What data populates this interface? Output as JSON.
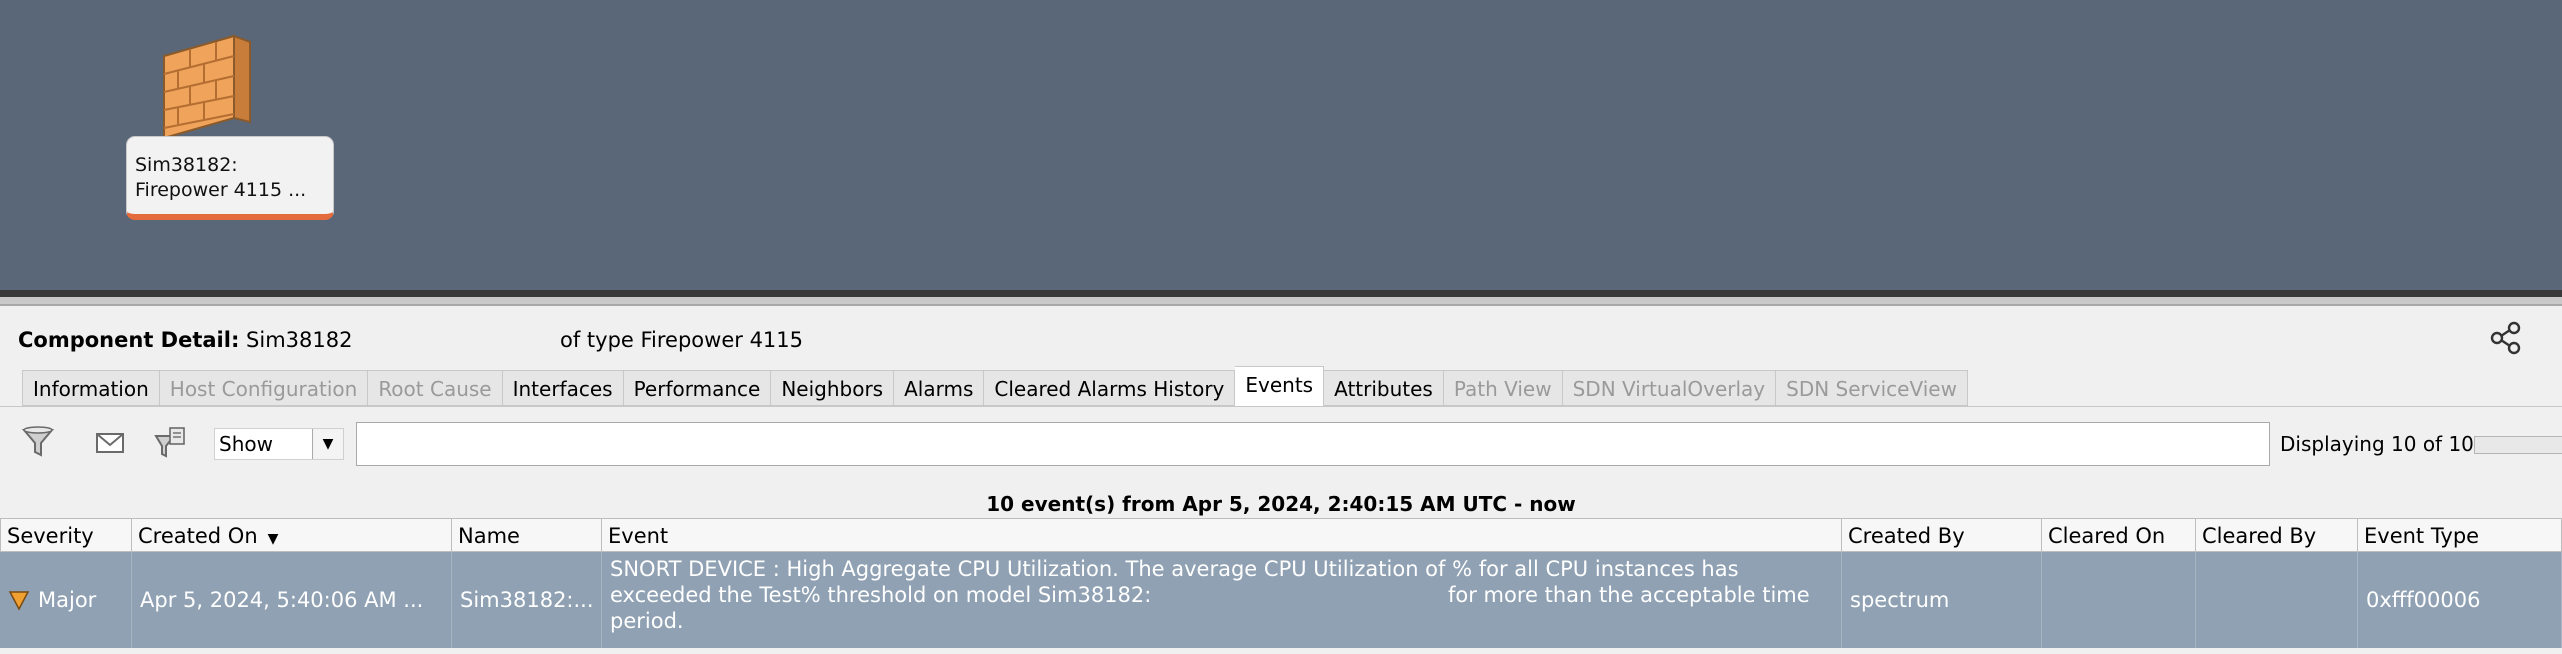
{
  "canvas": {
    "device": {
      "icon": "firewall-icon",
      "name_line1": "Sim38182:",
      "name_line2": "Firepower 4115 ..."
    }
  },
  "component_detail": {
    "label": "Component Detail:",
    "name": "Sim38182",
    "type_text": "of type Firepower 4115",
    "share_icon": "share-icon"
  },
  "tabs": [
    {
      "label": "Information",
      "state": "enabled"
    },
    {
      "label": "Host Configuration",
      "state": "disabled"
    },
    {
      "label": "Root Cause",
      "state": "disabled"
    },
    {
      "label": "Interfaces",
      "state": "enabled"
    },
    {
      "label": "Performance",
      "state": "enabled"
    },
    {
      "label": "Neighbors",
      "state": "enabled"
    },
    {
      "label": "Alarms",
      "state": "enabled"
    },
    {
      "label": "Cleared Alarms History",
      "state": "enabled"
    },
    {
      "label": "Events",
      "state": "active"
    },
    {
      "label": "Attributes",
      "state": "enabled"
    },
    {
      "label": "Path View",
      "state": "disabled"
    },
    {
      "label": "SDN VirtualOverlay",
      "state": "disabled"
    },
    {
      "label": "SDN ServiceView",
      "state": "disabled"
    }
  ],
  "toolbar": {
    "icons": [
      "filter-icon",
      "email-icon",
      "export-icon"
    ],
    "show_select": "Show",
    "filter_value": "",
    "display_count": "Displaying 10 of 10"
  },
  "events_summary": "10 event(s) from Apr 5, 2024, 2:40:15 AM UTC - now",
  "table": {
    "columns": [
      "Severity",
      "Created On",
      "Name",
      "Event",
      "Created By",
      "Cleared On",
      "Cleared By",
      "Event Type"
    ],
    "sorted_column": "Created On",
    "rows": [
      {
        "severity": "Major",
        "created_on": "Apr 5, 2024, 5:40:06 AM ...",
        "name": "Sim38182:...",
        "event_line1": "SNORT DEVICE : High Aggregate CPU Utilization. The average CPU Utilization of % for all CPU instances has",
        "event_line2a": "exceeded the Test% threshold on model Sim38182:",
        "event_line2b": "for more than the acceptable time",
        "event_line3": "period.",
        "created_by": "spectrum",
        "cleared_on": "",
        "cleared_by": "",
        "event_type": "0xfff00006"
      }
    ]
  },
  "colors": {
    "canvas_bg": "#5a6778",
    "row_selected": "#8fa1b3",
    "severity_major": "#f0a030",
    "device_accent": "#e36b3c"
  }
}
